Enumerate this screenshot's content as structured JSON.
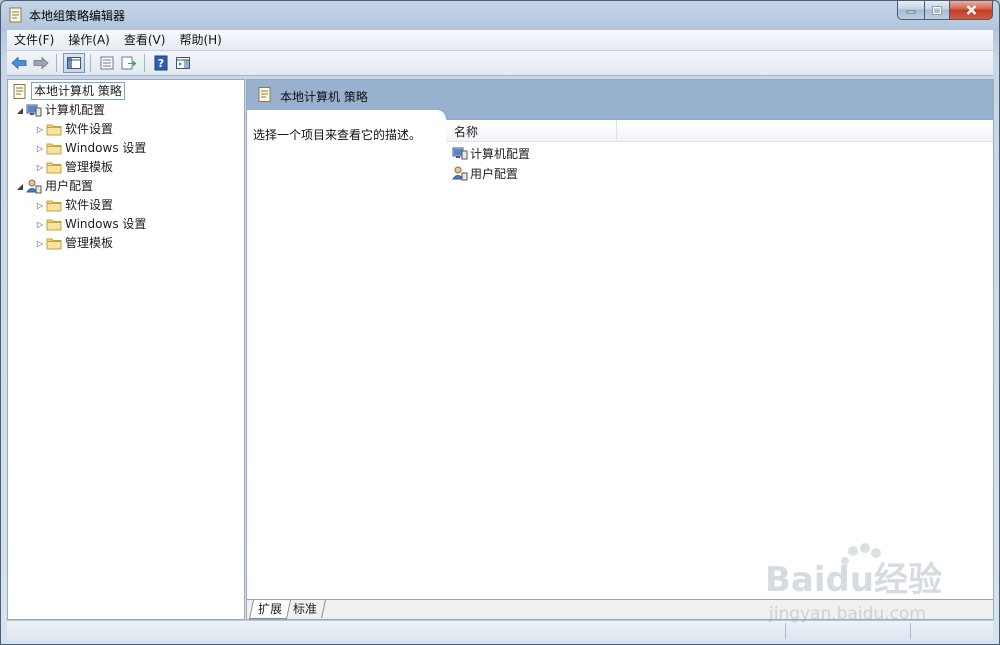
{
  "window": {
    "title": "本地组策略编辑器"
  },
  "menu": {
    "items": [
      "文件(F)",
      "操作(A)",
      "查看(V)",
      "帮助(H)"
    ]
  },
  "tree": {
    "root": "本地计算机 策略",
    "computer_config": "计算机配置",
    "user_config": "用户配置",
    "computer_children": [
      "软件设置",
      "Windows 设置",
      "管理模板"
    ],
    "user_children": [
      "软件设置",
      "Windows 设置",
      "管理模板"
    ]
  },
  "right_pane": {
    "header_title": "本地计算机 策略",
    "description": "选择一个项目来查看它的描述。",
    "column_name": "名称",
    "items": [
      "计算机配置",
      "用户配置"
    ]
  },
  "bottom_tabs": {
    "extended": "扩展",
    "standard": "标准"
  },
  "watermark": {
    "brand": "Baidu经验",
    "url": "jingyan.baidu.com"
  },
  "colors": {
    "header_bar": "#97b1cf",
    "selection_border": "#7da2ce",
    "close_button": "#c13c25"
  }
}
